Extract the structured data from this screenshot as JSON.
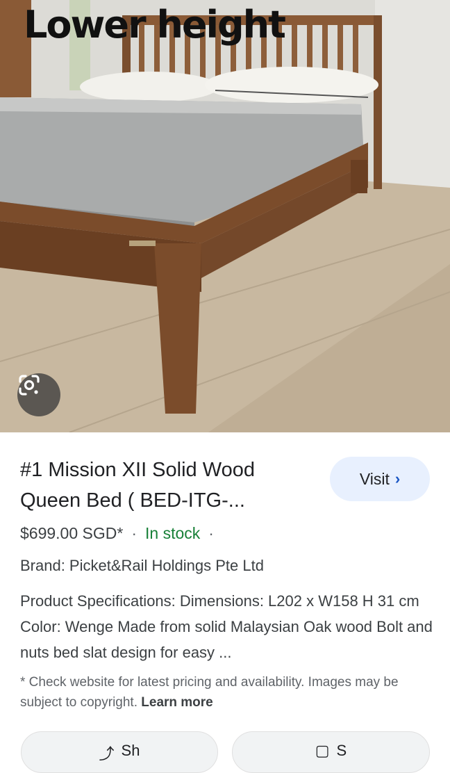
{
  "image": {
    "overlay_text": "Lower height"
  },
  "product": {
    "title": "#1 Mission XII Solid Wood Queen Bed ( BED-ITG-...",
    "visit_label": "Visit",
    "price": "$699.00 SGD*",
    "separator": "·",
    "stock_status": "In stock",
    "brand": "Brand: Picket&Rail Holdings Pte Ltd",
    "specs": "Product Specifications: Dimensions: L202 x W158 H 31 cm Color: Wenge Made from solid Malaysian Oak wood Bolt and nuts bed slat design for easy ...",
    "disclaimer": "* Check website for latest pricing and availability. Images may be subject to copyright.",
    "learn_more": "Learn more"
  },
  "actions": {
    "share_label": "Sh",
    "save_label": "S"
  },
  "colors": {
    "in_stock": "#188038",
    "visit_bg": "#e8f0fe",
    "accent": "#1a56c4"
  }
}
